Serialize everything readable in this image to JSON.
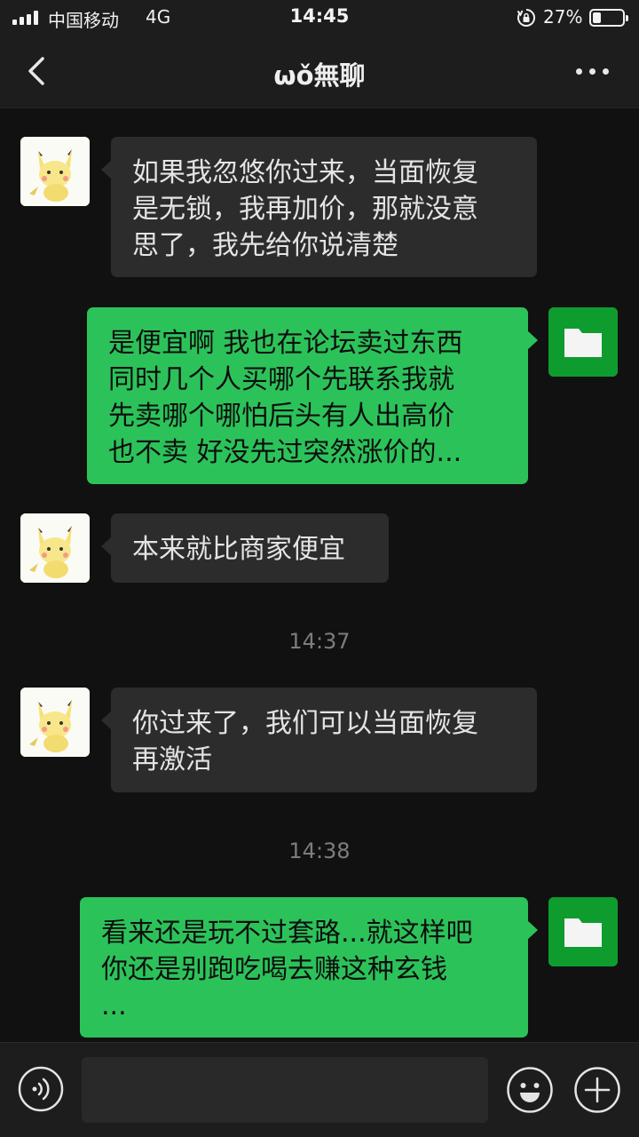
{
  "status_bar": {
    "carrier": "中国移动",
    "network": "4G",
    "time": "14:45",
    "battery_percent": "27%",
    "battery_level": 0.27,
    "signal_bars": 4
  },
  "header": {
    "title": "ωǒ無聊",
    "back_icon": "chevron-left-icon",
    "more_icon": "more-dots-icon"
  },
  "messages": [
    {
      "side": "in",
      "lines": [
        "如果我忽悠你过来，当面恢复",
        "是无锁，我再加价，那就没意",
        "思了，我先给你说清楚"
      ]
    },
    {
      "side": "out",
      "lines": [
        "是便宜啊 我也在论坛卖过东西",
        "同时几个人买哪个先联系我就",
        "先卖哪个哪怕后头有人出高价",
        "也不卖 好没先过突然涨价的..."
      ]
    },
    {
      "side": "in",
      "lines": [
        "本来就比商家便宜"
      ]
    },
    {
      "side": "in",
      "lines": [
        "你过来了，我们可以当面恢复",
        "再激活"
      ]
    },
    {
      "side": "out",
      "lines": [
        "看来还是玩不过套路...就这样吧",
        "你还是别跑吃喝去赚这种玄钱",
        "..."
      ]
    }
  ],
  "timestamps": [
    "14:37",
    "14:38"
  ],
  "input_bar": {
    "placeholder": "",
    "voice_icon": "voice-icon",
    "emoji_icon": "emoji-icon",
    "plus_icon": "plus-icon"
  },
  "colors": {
    "background": "#111111",
    "bar": "#1d1d1d",
    "incoming_bubble": "#2c2c2c",
    "outgoing_bubble": "#2cc25a",
    "outgoing_avatar": "#0e9c2e"
  }
}
